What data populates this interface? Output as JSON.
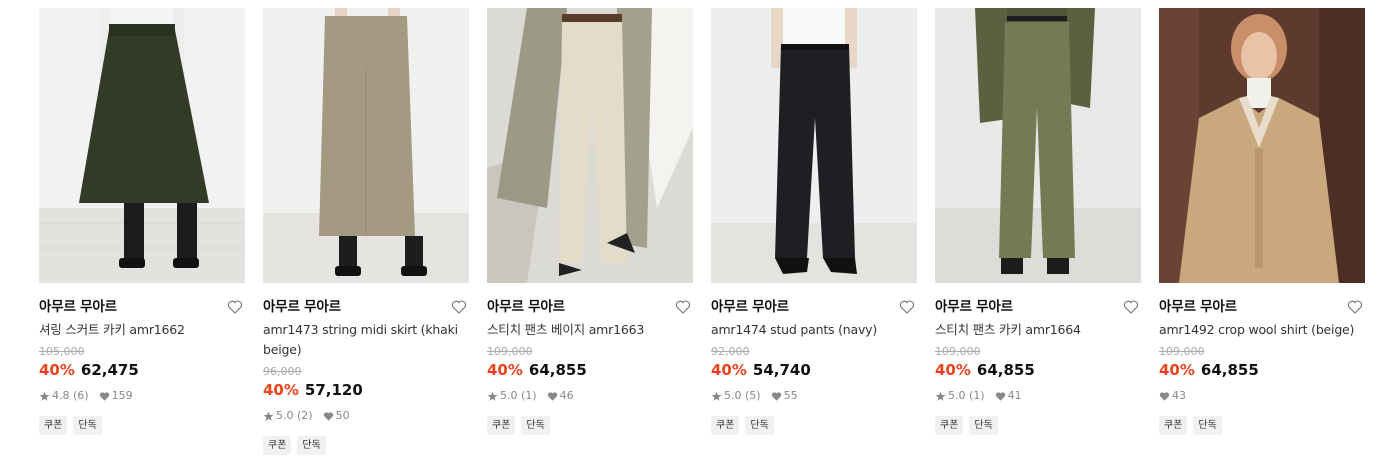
{
  "colors": {
    "discount": "#f0421b",
    "original_price": "#aaaaaa",
    "tag_bg": "#f1f1f1"
  },
  "products": [
    {
      "brand": "아무르 무아르",
      "name": "셔링 스커트 카키 amr1662",
      "original_price": "105,000",
      "discount": "40%",
      "price": "62,475",
      "rating": "4.8",
      "reviews": "(6)",
      "likes": "159",
      "tags": [
        "쿠폰",
        "단독"
      ],
      "image": "skirt-khaki-model"
    },
    {
      "brand": "아무르 무아르",
      "name": "amr1473 string midi skirt (khaki beige)",
      "original_price": "96,000",
      "discount": "40%",
      "price": "57,120",
      "rating": "5.0",
      "reviews": "(2)",
      "likes": "50",
      "tags": [
        "쿠폰",
        "단독"
      ],
      "image": "midi-skirt-beige-model"
    },
    {
      "brand": "아무르 무아르",
      "name": "스티치 팬츠 베이지 amr1663",
      "original_price": "109,000",
      "discount": "40%",
      "price": "64,855",
      "rating": "5.0",
      "reviews": "(1)",
      "likes": "46",
      "tags": [
        "쿠폰",
        "단독"
      ],
      "image": "pants-beige-model"
    },
    {
      "brand": "아무르 무아르",
      "name": "amr1474 stud pants (navy)",
      "original_price": "92,000",
      "discount": "40%",
      "price": "54,740",
      "rating": "5.0",
      "reviews": "(5)",
      "likes": "55",
      "tags": [
        "쿠폰",
        "단독"
      ],
      "image": "pants-navy-model"
    },
    {
      "brand": "아무르 무아르",
      "name": "스티치 팬츠 카키 amr1664",
      "original_price": "109,000",
      "discount": "40%",
      "price": "64,855",
      "rating": "5.0",
      "reviews": "(1)",
      "likes": "41",
      "tags": [
        "쿠폰",
        "단독"
      ],
      "image": "pants-khaki-model"
    },
    {
      "brand": "아무르 무아르",
      "name": "amr1492 crop wool shirt (beige)",
      "original_price": "109,000",
      "discount": "40%",
      "price": "64,855",
      "rating": null,
      "reviews": null,
      "likes": "43",
      "tags": [
        "쿠폰",
        "단독"
      ],
      "image": "wool-shirt-beige-model"
    }
  ]
}
